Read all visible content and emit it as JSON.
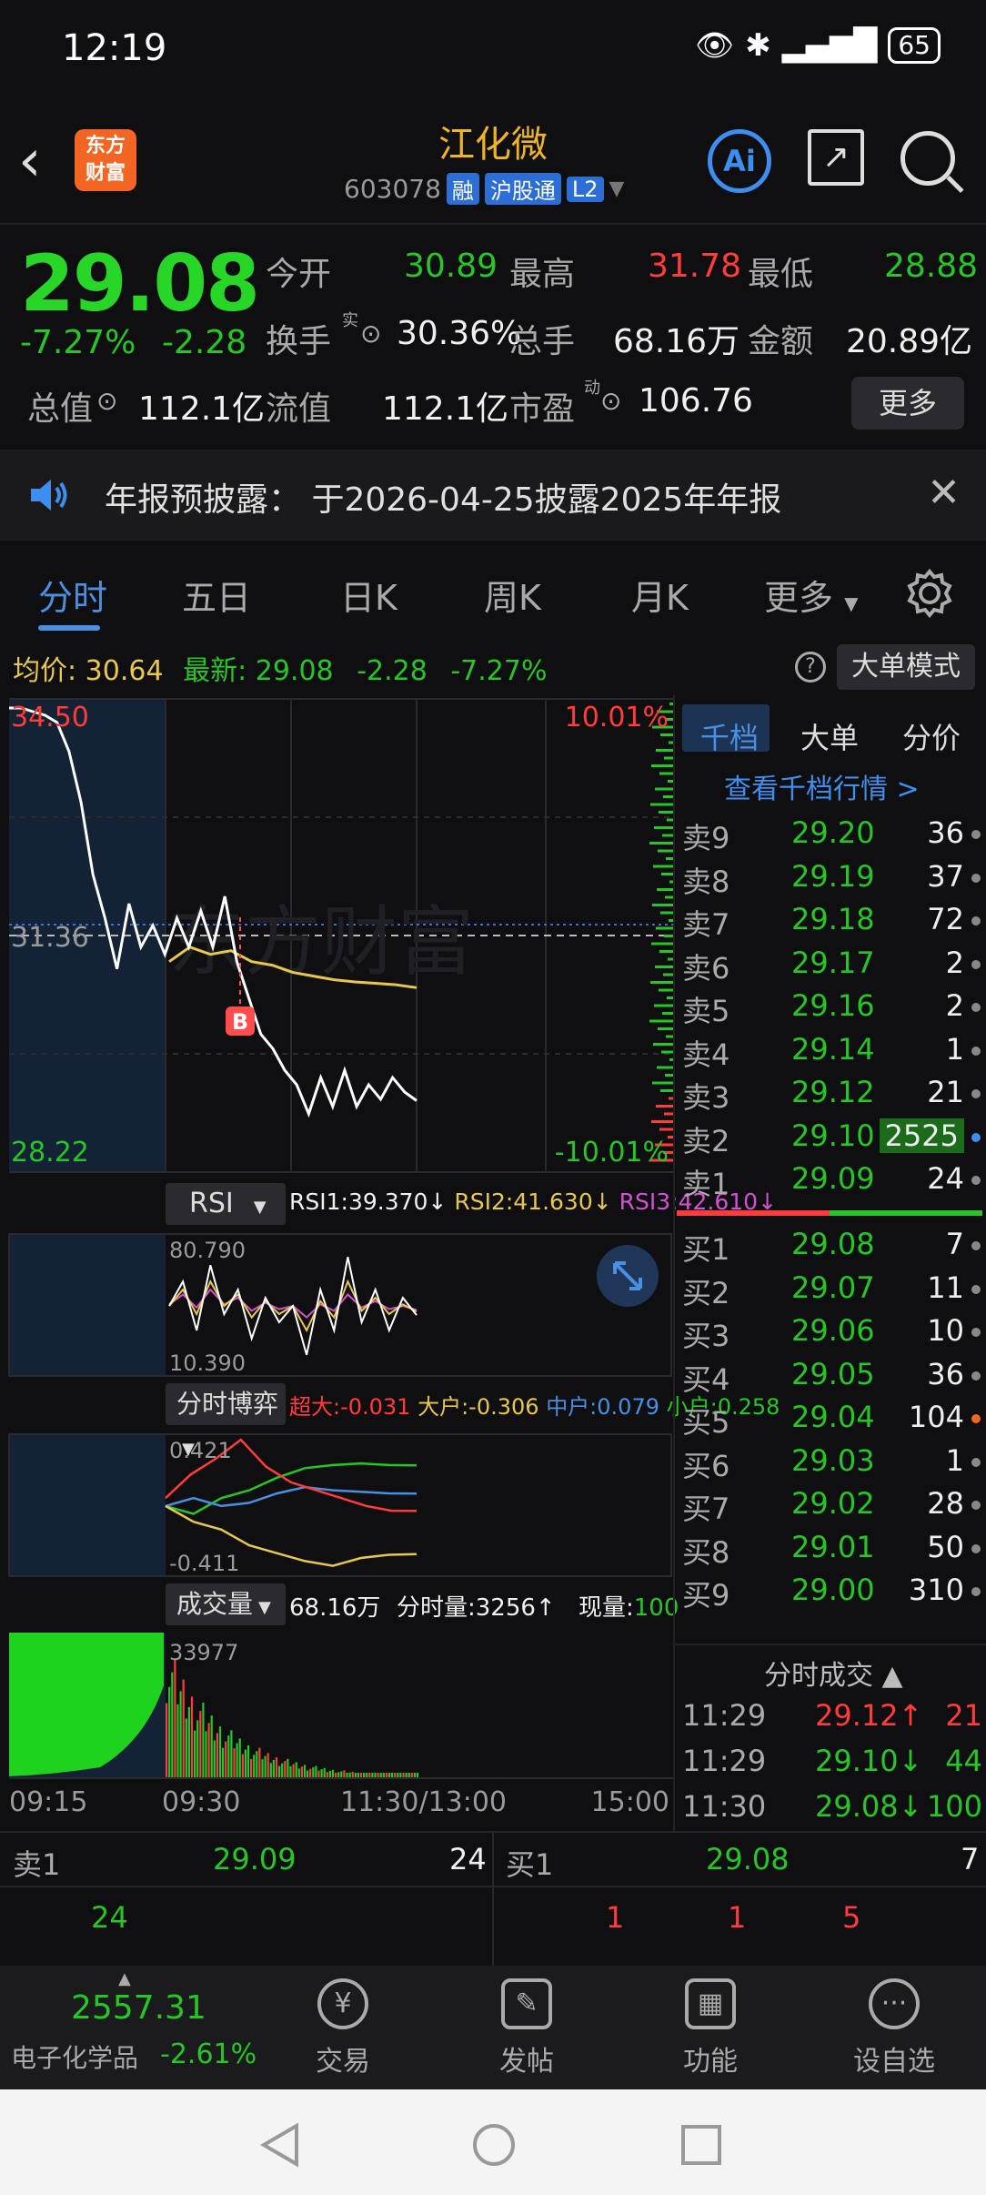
{
  "status_bar": {
    "time": "12:19",
    "battery": "65"
  },
  "header": {
    "logo_line1": "东方",
    "logo_line2": "财富",
    "stock_name": "江化微",
    "stock_code": "603078",
    "tag_margin": "融",
    "tag_connect": "沪股通",
    "tag_level": "L2",
    "ai_label": "Ai"
  },
  "quote": {
    "price": "29.08",
    "change_pct": "-7.27%",
    "change_amt": "-2.28",
    "open_label": "今开",
    "open": "30.89",
    "high_label": "最高",
    "high": "31.78",
    "low_label": "最低",
    "low": "28.88",
    "turnover_label": "换手",
    "turnover_sup": "实",
    "turnover": "30.36%",
    "volume_label": "总手",
    "volume": "68.16万",
    "amount_label": "金额",
    "amount": "20.89亿",
    "mktcap_label": "总值",
    "mktcap": "112.1亿",
    "float_label": "流值",
    "float_cap": "112.1亿",
    "pe_label": "市盈",
    "pe_sup": "动",
    "pe": "106.76",
    "more_label": "更多"
  },
  "notice": {
    "text": "年报预披露：  于2026-04-25披露2025年年报"
  },
  "tabs": [
    "分时",
    "五日",
    "日K",
    "周K",
    "月K",
    "更多"
  ],
  "chart_header": {
    "avg_label": "均价:",
    "avg": "30.64",
    "latest_label": "最新:",
    "latest": "29.08",
    "change_amt": "-2.28",
    "change_pct": "-7.27%",
    "mode_label": "大单模式",
    "help": "?"
  },
  "main_chart": {
    "y_top": "34.50",
    "y_mid": "31.36",
    "y_bottom": "28.22",
    "pct_top": "10.01%",
    "pct_bottom": "-10.01%",
    "marker": "B",
    "watermark": "东方财富"
  },
  "rsi": {
    "label": "RSI",
    "rsi1": "RSI1:39.370↓",
    "rsi2": "RSI2:41.630↓",
    "rsi3": "RSI3:42.610↓",
    "y_top": "80.790",
    "y_bottom": "10.390"
  },
  "game": {
    "label": "分时博弈",
    "super_large": "超大:-0.031",
    "large": "大户:-0.306",
    "medium": "中户:0.079",
    "small": "小户:0.258",
    "y_top": "0.421",
    "y_bottom": "-0.411"
  },
  "volume_panel": {
    "label": "成交量",
    "total": "68.16万",
    "tick_vol": "分时量:3256↑",
    "current": "现量:",
    "current_val": "100",
    "y_top": "33977",
    "x_labels": [
      "09:15",
      "09:30",
      "11:30/13:00",
      "15:00"
    ]
  },
  "chart_data": [
    {
      "type": "line",
      "title": "",
      "xlabel": "",
      "ylabel": "",
      "ylim": [
        28.22,
        34.5
      ],
      "grid": true,
      "series": [
        {
          "name": "",
          "values": [
            34.5,
            34.5,
            34.45,
            34.4,
            34.3,
            33.9,
            33.2,
            32.2,
            31.6,
            30.9,
            31.8,
            31.2,
            31.5,
            31.1,
            31.6,
            31.2,
            31.7,
            31.2,
            31.9,
            31.0,
            30.5,
            30.0,
            29.8,
            29.5,
            29.3,
            28.9,
            29.4,
            29.0,
            29.5,
            29.0,
            29.3,
            29.1,
            29.4,
            29.2,
            29.08
          ]
        },
        {
          "name": "",
          "values": [
            31.0,
            31.2,
            31.1,
            31.15,
            31.0,
            30.95,
            30.85,
            30.8,
            30.75,
            30.72,
            30.7,
            30.68,
            30.64
          ]
        }
      ]
    },
    {
      "type": "line",
      "title": "RSI",
      "ylim": [
        10.39,
        80.79
      ],
      "series": [
        {
          "name": "RSI1",
          "values": [
            45,
            60,
            30,
            70,
            40,
            55,
            25,
            50,
            35,
            45,
            15,
            55,
            30,
            75,
            35,
            55,
            30,
            50,
            39.37
          ]
        },
        {
          "name": "RSI2",
          "values": [
            45,
            55,
            40,
            60,
            45,
            52,
            38,
            48,
            40,
            45,
            30,
            48,
            38,
            60,
            42,
            50,
            40,
            46,
            41.63
          ]
        },
        {
          "name": "RSI3",
          "values": [
            46,
            52,
            44,
            55,
            46,
            50,
            42,
            47,
            43,
            45,
            38,
            46,
            42,
            52,
            44,
            48,
            43,
            45,
            42.61
          ]
        }
      ]
    },
    {
      "type": "line",
      "title": "分时博弈",
      "ylim": [
        -0.411,
        0.421
      ],
      "series": [
        {
          "name": "超大",
          "values": [
            0.05,
            0.2,
            0.3,
            0.421,
            0.25,
            0.15,
            0.1,
            0.05,
            0.0,
            -0.03,
            -0.031
          ]
        },
        {
          "name": "大户",
          "values": [
            0.0,
            -0.1,
            -0.15,
            -0.25,
            -0.3,
            -0.35,
            -0.38,
            -0.33,
            -0.31,
            -0.306
          ]
        },
        {
          "name": "中户",
          "values": [
            0.0,
            0.05,
            0.0,
            0.02,
            0.08,
            0.12,
            0.1,
            0.09,
            0.08,
            0.079
          ]
        },
        {
          "name": "小户",
          "values": [
            0.0,
            -0.05,
            0.05,
            0.1,
            0.18,
            0.24,
            0.26,
            0.27,
            0.26,
            0.258
          ]
        }
      ]
    }
  ],
  "order_book": {
    "tabs": [
      "千档",
      "大单",
      "分价"
    ],
    "link": "查看千档行情 >",
    "sell": [
      {
        "label": "卖9",
        "price": "29.20",
        "vol": "36"
      },
      {
        "label": "卖8",
        "price": "29.19",
        "vol": "37"
      },
      {
        "label": "卖7",
        "price": "29.18",
        "vol": "72"
      },
      {
        "label": "卖6",
        "price": "29.17",
        "vol": "2"
      },
      {
        "label": "卖5",
        "price": "29.16",
        "vol": "2"
      },
      {
        "label": "卖4",
        "price": "29.14",
        "vol": "1"
      },
      {
        "label": "卖3",
        "price": "29.12",
        "vol": "21"
      },
      {
        "label": "卖2",
        "price": "29.10",
        "vol": "2525"
      },
      {
        "label": "卖1",
        "price": "29.09",
        "vol": "24"
      }
    ],
    "buy": [
      {
        "label": "买1",
        "price": "29.08",
        "vol": "7"
      },
      {
        "label": "买2",
        "price": "29.07",
        "vol": "11"
      },
      {
        "label": "买3",
        "price": "29.06",
        "vol": "10"
      },
      {
        "label": "买4",
        "price": "29.05",
        "vol": "36"
      },
      {
        "label": "买5",
        "price": "29.04",
        "vol": "104"
      },
      {
        "label": "买6",
        "price": "29.03",
        "vol": "1"
      },
      {
        "label": "买7",
        "price": "29.02",
        "vol": "28"
      },
      {
        "label": "买8",
        "price": "29.01",
        "vol": "50"
      },
      {
        "label": "买9",
        "price": "29.00",
        "vol": "310"
      }
    ],
    "trades_label": "分时成交",
    "trades": [
      {
        "time": "11:29",
        "price": "29.12↑",
        "vol": "21"
      },
      {
        "time": "11:29",
        "price": "29.10↓",
        "vol": "44"
      },
      {
        "time": "11:30",
        "price": "29.08↓",
        "vol": "100"
      }
    ]
  },
  "summary": {
    "sell_label": "卖1",
    "sell_price": "29.09",
    "sell_vol": "24",
    "sell_queue": [
      "24"
    ],
    "buy_label": "买1",
    "buy_price": "29.08",
    "buy_vol": "7",
    "buy_queue": [
      "1",
      "1",
      "5"
    ]
  },
  "bottom_nav": {
    "index_value": "2557.31",
    "index_name": "电子化学品",
    "index_change": "-2.61%",
    "items": [
      "交易",
      "发帖",
      "功能",
      "设自选"
    ]
  },
  "colors": {
    "up": "#ff3b3b",
    "down": "#27c627",
    "accent": "#4a90e2",
    "brand": "#f26522"
  }
}
